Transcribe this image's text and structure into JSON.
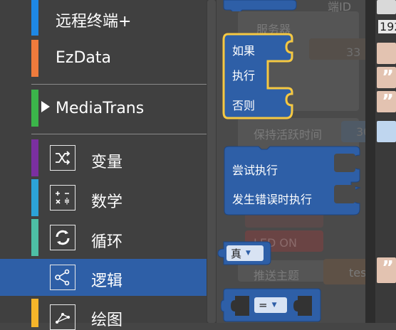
{
  "sidebar": {
    "items": [
      {
        "label": "远程终端+",
        "color": "#1e88e5"
      },
      {
        "label": "EzData",
        "color": "#ef7b3c"
      },
      {
        "label": "MediaTrans",
        "color": "#3bb54a"
      },
      {
        "label": "变量",
        "color": "#7b2fa0",
        "icon": "shuffle-icon"
      },
      {
        "label": "数学",
        "color": "#2ca3d8",
        "icon": "math-icon"
      },
      {
        "label": "循环",
        "color": "#4dbfa5",
        "icon": "loop-icon"
      },
      {
        "label": "逻辑",
        "color": "#2e5fa7",
        "icon": "logic-icon"
      },
      {
        "label": "绘图",
        "color": "#f5b52a",
        "icon": "graph-icon"
      }
    ]
  },
  "blocks": {
    "if_else": {
      "if": "如果",
      "then": "执行",
      "else": "否则"
    },
    "try_catch": {
      "try": "尝试执行",
      "catch": "发生错误时执行"
    },
    "boolean": {
      "value": "真"
    },
    "compare": {
      "operator": "="
    }
  },
  "background": {
    "faded_labels": [
      "服务器",
      "保持活跃时间",
      "推送主题",
      "LED ON",
      "端ID"
    ],
    "right_values": [
      "192",
      "33",
      "30",
      "tes"
    ]
  },
  "colors": {
    "block_blue": "#2e5fa7",
    "highlight": "#f5c842"
  }
}
